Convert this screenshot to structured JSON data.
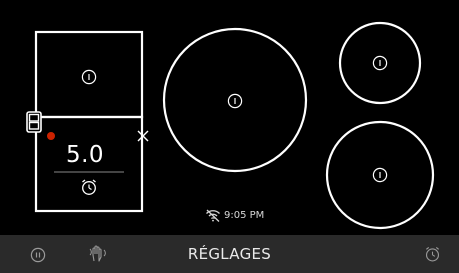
{
  "status": {
    "time": "9:05 PM",
    "wifi_icon": "wifi-off-icon"
  },
  "cooktop": {
    "zones": [
      {
        "id": "front-left-bridge",
        "shape": "bridge",
        "selected": true,
        "power_level": "5.0",
        "indicator_color": "#cc2200"
      },
      {
        "id": "center-large",
        "shape": "circle",
        "selected": false
      },
      {
        "id": "rear-right-small",
        "shape": "circle",
        "selected": false
      },
      {
        "id": "front-right-medium",
        "shape": "circle",
        "selected": false
      }
    ]
  },
  "bottom_bar": {
    "settings_label": "RÉGLAGES",
    "icons": [
      "pause-icon",
      "hand-wave-icon",
      "timer-icon"
    ]
  },
  "colors": {
    "background": "#000000",
    "bar": "#2a2a2a",
    "zone_outline": "#ffffff",
    "indicator": "#cc2200"
  }
}
